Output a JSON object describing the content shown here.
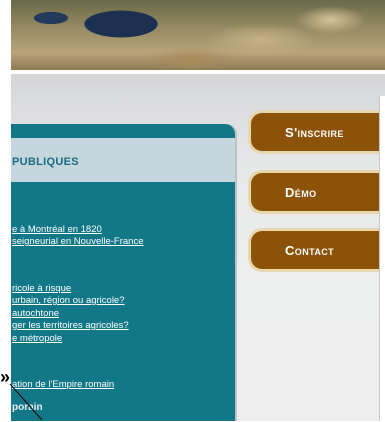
{
  "nav": {
    "register_label": "S'inscrire",
    "demo_label": "Démo",
    "contact_label": "Contact"
  },
  "panel": {
    "title": "PUBLIQUES",
    "links": [
      "e à Montréal en 1820",
      "seigneurial en Nouvelle-France",
      "ricole à risque",
      "urbain, région ou agricole?",
      "autochtone",
      "ger les territoires agricoles?",
      "e métropole",
      "ation de l'Empire romain"
    ],
    "section_heading": "porain",
    "arrow_glyph": "»"
  },
  "colors": {
    "panel": "#127787",
    "panel_header": "#c5d6de",
    "button": "#8b5208",
    "button_border": "#e7d7ae"
  }
}
